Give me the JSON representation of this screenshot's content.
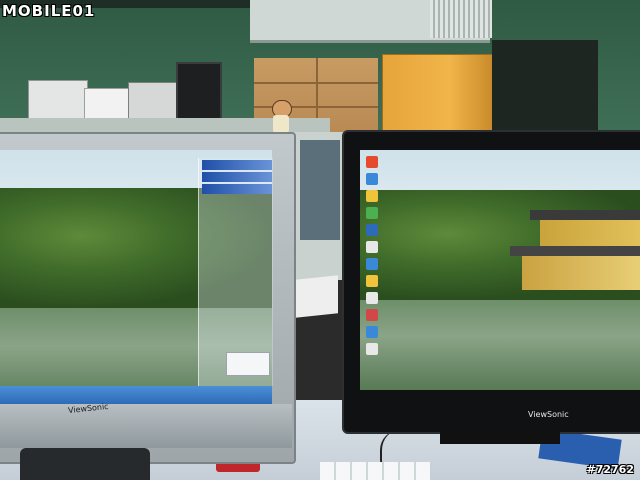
{
  "photo": {
    "watermark": "MOBILE01",
    "photo_id": "#72762"
  },
  "left_monitor": {
    "brand": "ViewSonic"
  },
  "right_monitor": {
    "brand": "ViewSonic"
  },
  "colors": {
    "wall": "#3e6d55",
    "desk": "#dbe3ea",
    "left_bezel": "#b7bfc3",
    "right_bezel": "#0f1112",
    "taskbar": "#2d6bb8",
    "door": "#f1b54a"
  }
}
